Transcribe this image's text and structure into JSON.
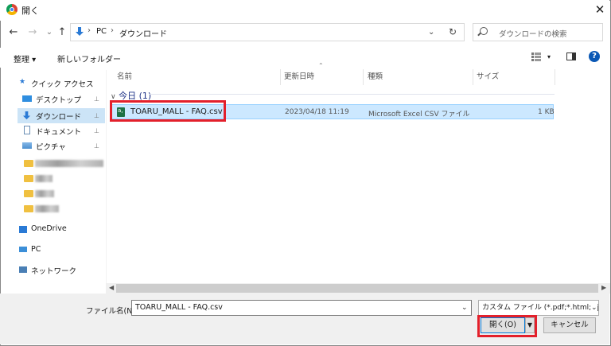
{
  "window": {
    "title": "開く"
  },
  "nav": {
    "back": "←",
    "forward": "→",
    "recent": "⌄",
    "up": "↑"
  },
  "address": {
    "crumbs": [
      "PC",
      "ダウンロード"
    ],
    "separator": "›"
  },
  "search": {
    "placeholder": "ダウンロードの検索"
  },
  "toolbar": {
    "organize": "整理 ▾",
    "new_folder": "新しいフォルダー",
    "view_caret": "▾"
  },
  "sidebar": {
    "items": [
      {
        "label": "クイック アクセス",
        "icon": "star-icon"
      },
      {
        "label": "デスクトップ",
        "icon": "desktop-icon",
        "pinned": true
      },
      {
        "label": "ダウンロード",
        "icon": "download-icon",
        "pinned": true,
        "selected": true
      },
      {
        "label": "ドキュメント",
        "icon": "document-icon",
        "pinned": true
      },
      {
        "label": "ピクチャ",
        "icon": "pictures-icon",
        "pinned": true
      },
      {
        "label": "OneDrive",
        "icon": "onedrive-icon"
      },
      {
        "label": "PC",
        "icon": "pc-icon"
      },
      {
        "label": "ネットワーク",
        "icon": "network-icon"
      }
    ],
    "pin_glyph": "📌"
  },
  "columns": {
    "name": "名前",
    "modified": "更新日時",
    "type": "種類",
    "size": "サイズ"
  },
  "group": {
    "label": "今日 (1)"
  },
  "files": [
    {
      "name": "TOARU_MALL - FAQ.csv",
      "modified": "2023/04/18 11:19",
      "type": "Microsoft Excel CSV ファイル",
      "size": "1 KB"
    }
  ],
  "bottom": {
    "filename_label": "ファイル名(N):",
    "filename_value": "TOARU_MALL - FAQ.csv",
    "filter_value": "カスタム ファイル (*.pdf;*.html;*.jsc",
    "open_label": "開く(O)",
    "cancel_label": "キャンセル"
  },
  "colors": {
    "selection": "#cce8ff",
    "highlight_box": "#e3202b",
    "accent": "#0078d7"
  }
}
